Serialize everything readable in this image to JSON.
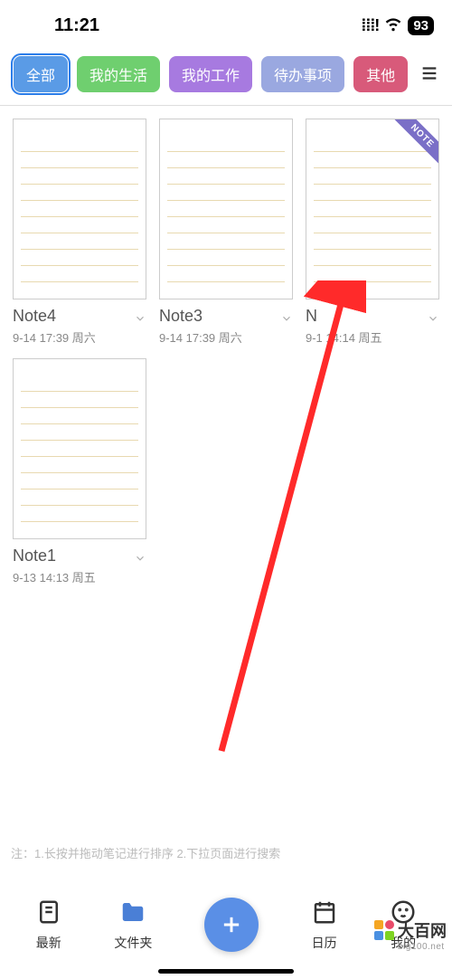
{
  "status": {
    "time": "11:21",
    "battery": "93"
  },
  "tabs": [
    {
      "label": "全部",
      "color": "#5a9be6",
      "active": true
    },
    {
      "label": "我的生活",
      "color": "#6fcf6f",
      "active": false
    },
    {
      "label": "我的工作",
      "color": "#a77ae0",
      "active": false
    },
    {
      "label": "待办事项",
      "color": "#9aa8e0",
      "active": false
    },
    {
      "label": "其他",
      "color": "#d85a7a",
      "active": false
    }
  ],
  "notes": [
    {
      "title": "Note4",
      "date": "9-14 17:39  周六",
      "ribbon": null
    },
    {
      "title": "Note3",
      "date": "9-14 17:39  周六",
      "ribbon": null
    },
    {
      "title": "N",
      "date": "9-1   14:14  周五",
      "ribbon": "NOTE"
    },
    {
      "title": "Note1",
      "date": "9-13 14:13  周五",
      "ribbon": null
    }
  ],
  "hint": "注：1.长按并拖动笔记进行排序   2.下拉页面进行搜索",
  "nav": {
    "latest": "最新",
    "folder": "文件夹",
    "calendar": "日历",
    "mine": "我的"
  },
  "watermark": {
    "name": "大百网",
    "url": "big100.net"
  }
}
